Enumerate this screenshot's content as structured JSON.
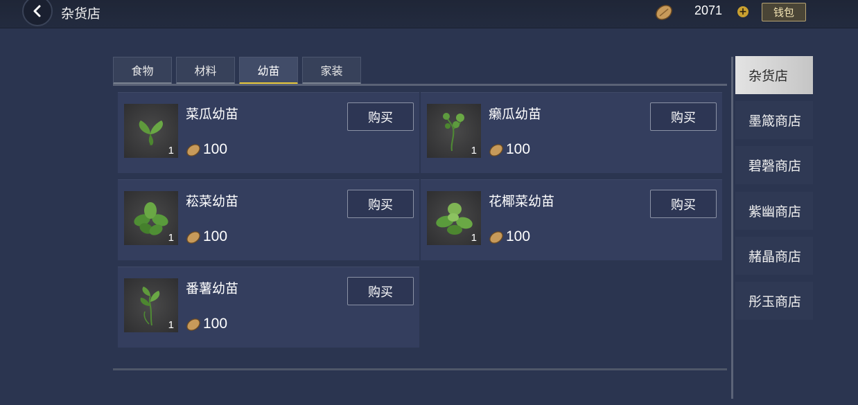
{
  "header": {
    "title": "杂货店",
    "currency_value": "2071",
    "wallet_label": "钱包"
  },
  "tabs": [
    {
      "label": "食物",
      "active": false
    },
    {
      "label": "材料",
      "active": false
    },
    {
      "label": "幼苗",
      "active": true
    },
    {
      "label": "家装",
      "active": false
    }
  ],
  "items": [
    {
      "name": "菜瓜幼苗",
      "count": "1",
      "price": "100",
      "buy_label": "购买",
      "icon": "seedling-leaves-icon"
    },
    {
      "name": "癞瓜幼苗",
      "count": "1",
      "price": "100",
      "buy_label": "购买",
      "icon": "seedling-vine-icon"
    },
    {
      "name": "菘菜幼苗",
      "count": "1",
      "price": "100",
      "buy_label": "购买",
      "icon": "seedling-cabbage-icon"
    },
    {
      "name": "花椰菜幼苗",
      "count": "1",
      "price": "100",
      "buy_label": "购买",
      "icon": "seedling-cauliflower-icon"
    },
    {
      "name": "番薯幼苗",
      "count": "1",
      "price": "100",
      "buy_label": "购买",
      "icon": "seedling-sweetpotato-icon"
    }
  ],
  "sidebar": {
    "items": [
      {
        "label": "杂货店",
        "active": true
      },
      {
        "label": "墨箴商店",
        "active": false
      },
      {
        "label": "碧磬商店",
        "active": false
      },
      {
        "label": "紫幽商店",
        "active": false
      },
      {
        "label": "赭晶商店",
        "active": false
      },
      {
        "label": "彤玉商店",
        "active": false
      }
    ]
  },
  "colors": {
    "background": "#2b3550",
    "card": "#343e5e",
    "active_tab_underline": "#e9c93a",
    "wallet_border": "#b8a574"
  }
}
